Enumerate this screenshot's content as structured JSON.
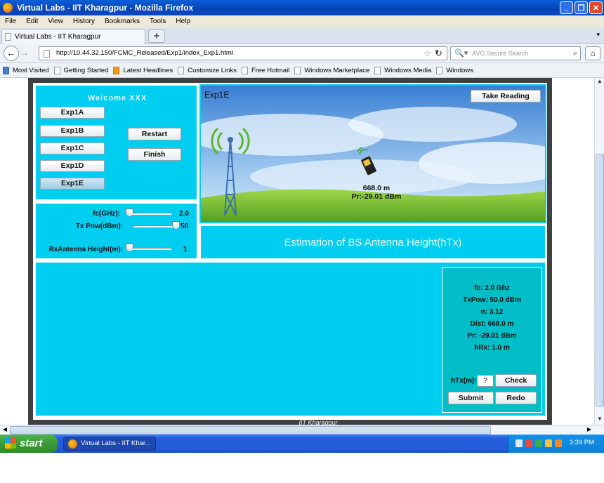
{
  "window": {
    "title": "Virtual Labs - IIT Kharagpur - Mozilla Firefox"
  },
  "menu": [
    "File",
    "Edit",
    "View",
    "History",
    "Bookmarks",
    "Tools",
    "Help"
  ],
  "tab": {
    "label": "Virtual Labs - IIT Kharagpur"
  },
  "nav": {
    "url": "http://10.44.32.150/FCMC_Released/Exp1/index_Exp1.html",
    "search_placeholder": "AVG Secure Search"
  },
  "bookmarks": [
    "Most Visited",
    "Getting Started",
    "Latest Headlines",
    "Customize Links",
    "Free Hotmail",
    "Windows Marketplace",
    "Windows Media",
    "Windows"
  ],
  "applet": {
    "welcome": "Welcome   XXX",
    "experiments": [
      "Exp1A",
      "Exp1B",
      "Exp1C",
      "Exp1D",
      "Exp1E"
    ],
    "selected_experiment": "Exp1E",
    "restart_label": "Restart",
    "finish_label": "Finish",
    "sliders": [
      {
        "label": "fc(GHz):",
        "value": "2.0",
        "level": 0.0
      },
      {
        "label": "Tx Pow(dBm):",
        "value": "50",
        "level": 1.0
      },
      {
        "label": "RxAntenna Height(m):",
        "value": "1",
        "level": 0.0
      }
    ],
    "scene": {
      "title": "Exp1E",
      "take_reading_label": "Take Reading",
      "distance": "668.0 m",
      "power": "Pr:-29.01 dBm"
    },
    "estimation_title": "Estimation of BS Antenna Height(hTx)",
    "results": {
      "fc": "fc: 2.0 Ghz",
      "txpow": "TxPow: 50.0 dBm",
      "n": "n: 3.12",
      "dist": "Dist: 668.0 m",
      "pr": "Pr: -29.01 dBm",
      "hrx": "hRx: 1.0 m",
      "htx_label": "hTx(m):",
      "htx_value": "?",
      "check_label": "Check",
      "submit_label": "Submit",
      "redo_label": "Redo"
    },
    "footer": "IIT Kharagpur"
  },
  "taskbar": {
    "start_label": "start",
    "task_label": "Virtual Labs - IIT Khar...",
    "clock": "3:39 PM"
  }
}
